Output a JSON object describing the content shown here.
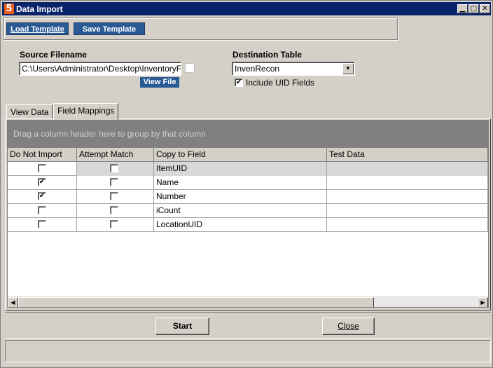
{
  "window": {
    "app_icon": "5",
    "title": "Data Import",
    "controls": {
      "minimize": "▁",
      "maximize": "□",
      "close": "✕"
    }
  },
  "toolbar": {
    "load_template": "Load Template",
    "save_template": "Save Template"
  },
  "source": {
    "label": "Source Filename",
    "value": "C:\\Users\\Administrator\\Desktop\\InventoryF",
    "view_file": "View File"
  },
  "destination": {
    "label": "Destination Table",
    "value": "InvenRecon",
    "include_uid_label": "Include UID Fields",
    "include_uid_checked": true
  },
  "tabs": [
    {
      "label": "View Data",
      "active": false
    },
    {
      "label": "Field Mappings",
      "active": true
    }
  ],
  "grid": {
    "group_hint": "Drag a column header here to group by that column",
    "columns": [
      "Do Not Import",
      "Attempt Match",
      "Copy to Field",
      "Test Data"
    ],
    "rows": [
      {
        "do_not_import": false,
        "attempt_match": false,
        "field": "ItemUID",
        "test_data": ""
      },
      {
        "do_not_import": true,
        "attempt_match": false,
        "field": "Name",
        "test_data": ""
      },
      {
        "do_not_import": true,
        "attempt_match": false,
        "field": "Number",
        "test_data": ""
      },
      {
        "do_not_import": false,
        "attempt_match": false,
        "field": "iCount",
        "test_data": ""
      },
      {
        "do_not_import": false,
        "attempt_match": false,
        "field": "LocationUID",
        "test_data": ""
      }
    ],
    "selected_row": 0
  },
  "buttons": {
    "start": "Start",
    "close": "Close"
  },
  "icons": {
    "check": "✔",
    "dropdown": "▼",
    "scroll_left": "◀",
    "scroll_right": "▶"
  }
}
